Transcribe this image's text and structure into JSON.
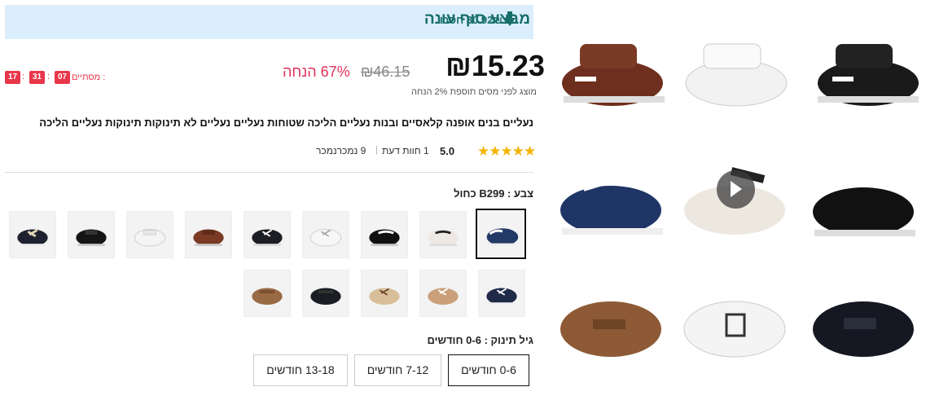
{
  "banner": {
    "title": "מבצע סוף עונה",
    "save_text": "30.92₪ חסכו"
  },
  "price": {
    "current": "₪15.23",
    "original": "₪46.15",
    "discount": "67% הנחה",
    "tax_note": "מוצג לפני מסים תוספת 2% הנחה"
  },
  "countdown": {
    "label": "מסתיים :",
    "hours": "07",
    "minutes": "31",
    "seconds": "17",
    "sep": ":"
  },
  "product": {
    "title": "נעליים בנים אופנה קלאסיים ובנות נעליים הליכה שטוחות נעליים נעליים לא תינוקות תינוקות נעליים הליכה"
  },
  "rating": {
    "stars": "★★★★★",
    "value": "5.0",
    "reviews": "1 חוות דעת",
    "sold": "9 נמכרנמכר",
    "sep": "|"
  },
  "color": {
    "label": "צבע : B299 כחול"
  },
  "size": {
    "label": "גיל תינוק : 0-6 חודשים",
    "options": [
      "0-6 חודשים",
      "7-12 חודשים",
      "13-18 חודשים"
    ]
  },
  "colors": {
    "accent": "#176e6b",
    "sale": "#e0315a",
    "banner_bg": "#dbeefc",
    "star": "#f5b301"
  }
}
